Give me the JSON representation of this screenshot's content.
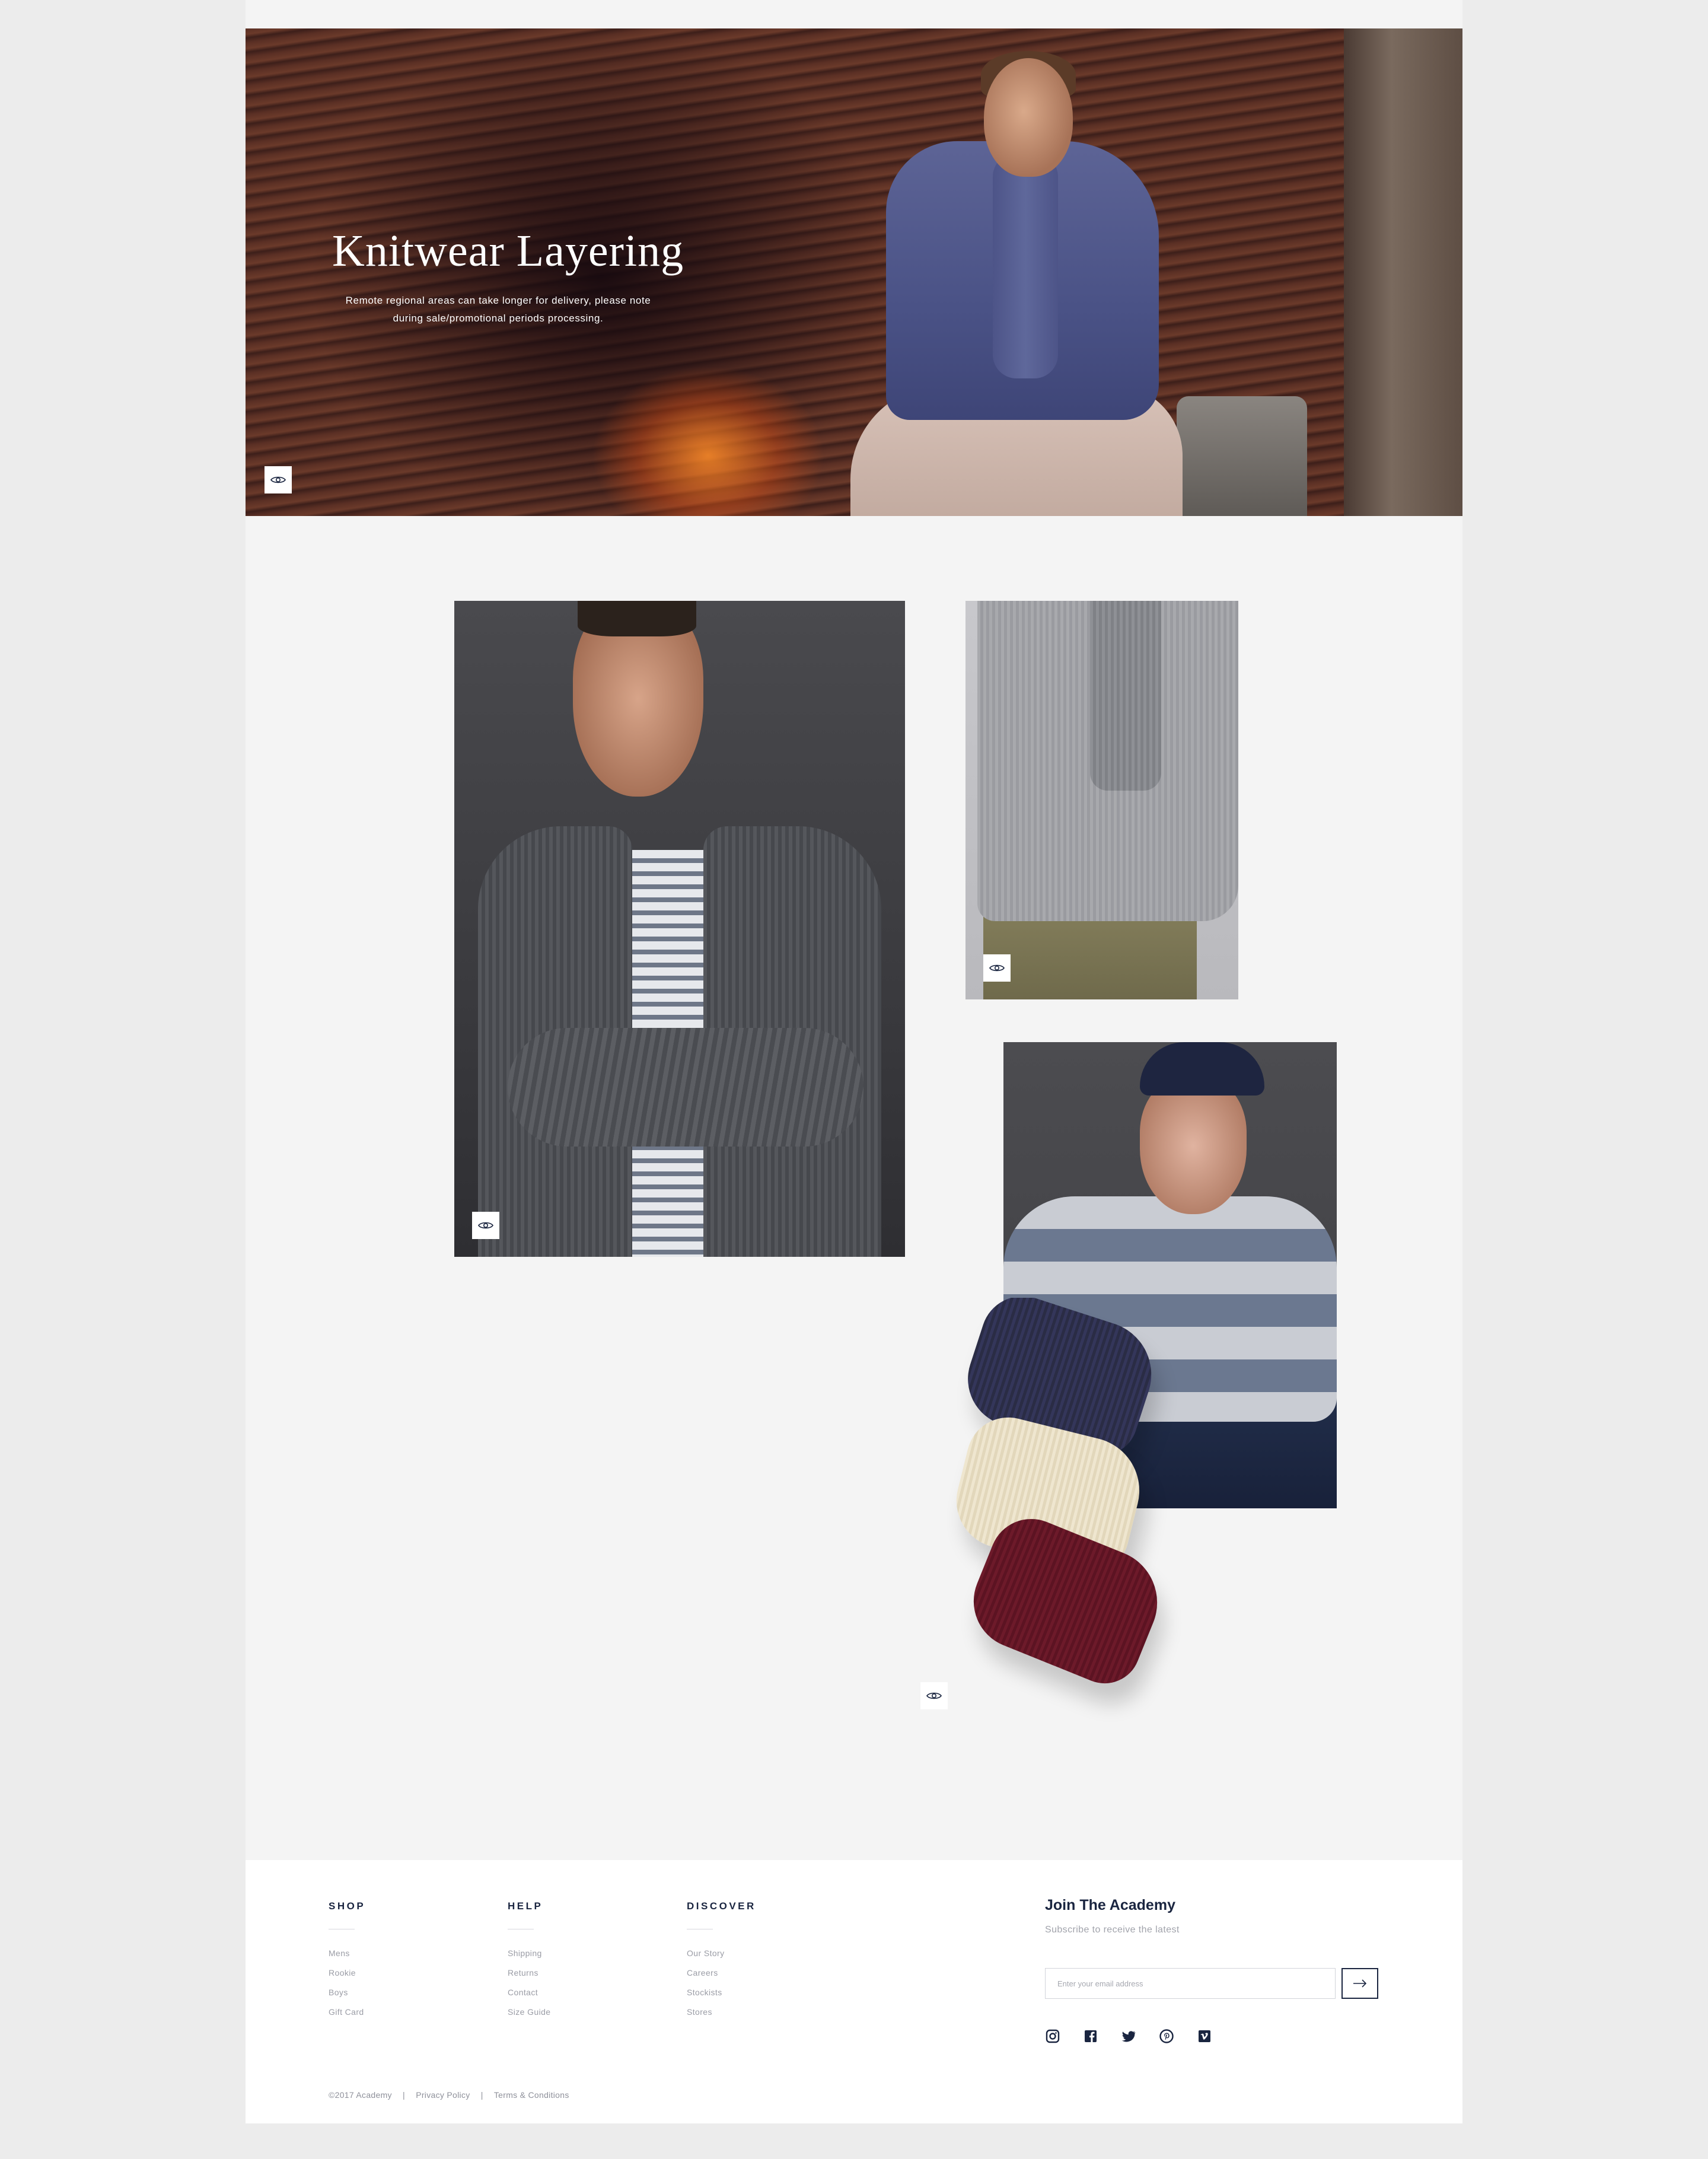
{
  "hero": {
    "title": "Knitwear Layering",
    "subtitle": "Remote regional areas can take longer for delivery, please note during sale/promotional periods processing."
  },
  "icons": {
    "quick_view": "eye-icon",
    "submit": "arrow-right-icon",
    "social": [
      "instagram-icon",
      "facebook-icon",
      "twitter-icon",
      "pinterest-icon",
      "vimeo-icon"
    ]
  },
  "footer": {
    "shop": {
      "heading": "SHOP",
      "links": [
        "Mens",
        "Rookie",
        "Boys",
        "Gift Card"
      ]
    },
    "help": {
      "heading": "HELP",
      "links": [
        "Shipping",
        "Returns",
        "Contact",
        "Size Guide"
      ]
    },
    "discover": {
      "heading": "DISCOVER",
      "links": [
        "Our Story",
        "Careers",
        "Stockists",
        "Stores"
      ]
    },
    "newsletter": {
      "title": "Join The Academy",
      "subtitle": "Subscribe to receive the latest",
      "placeholder": "Enter your email address"
    },
    "legal": {
      "copyright": "©2017 Academy",
      "separator": "|",
      "privacy": "Privacy Policy",
      "terms": "Terms & Conditions"
    }
  },
  "colors": {
    "navy": "#1a2540",
    "page_bg": "#f4f4f4",
    "outer_bg": "#ececec",
    "muted_text": "#9a9ca5"
  }
}
